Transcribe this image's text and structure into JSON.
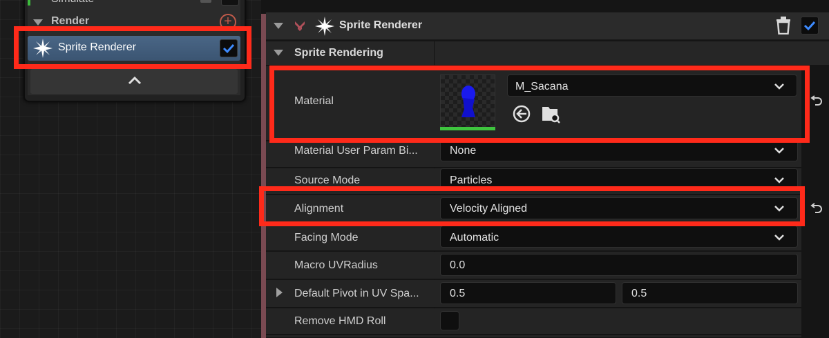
{
  "node": {
    "simulate_label": "Simulate",
    "render_label": "Render",
    "sprite_item_label": "Sprite Renderer",
    "sprite_item_enabled": true
  },
  "details": {
    "title": "Sprite Renderer",
    "enabled": true,
    "section": "Sprite Rendering",
    "material": {
      "label": "Material",
      "value": "M_Sacana"
    },
    "rows": [
      {
        "label": "Material User Param Bi...",
        "value": "None"
      },
      {
        "label": "Source Mode",
        "value": "Particles"
      },
      {
        "label": "Alignment",
        "value": "Velocity Aligned"
      },
      {
        "label": "Facing Mode",
        "value": "Automatic"
      },
      {
        "label": "Macro UVRadius",
        "value": "0.0"
      },
      {
        "label": "Default Pivot in UV Spa...",
        "value_x": "0.5",
        "value_y": "0.5"
      },
      {
        "label": "Remove HMD Roll",
        "checked": false
      }
    ]
  },
  "colors": {
    "highlight": "#ff2a1a",
    "selected_item": "#4a6686",
    "check": "#3d8bff",
    "emitter_accent": "#7a4a52"
  }
}
